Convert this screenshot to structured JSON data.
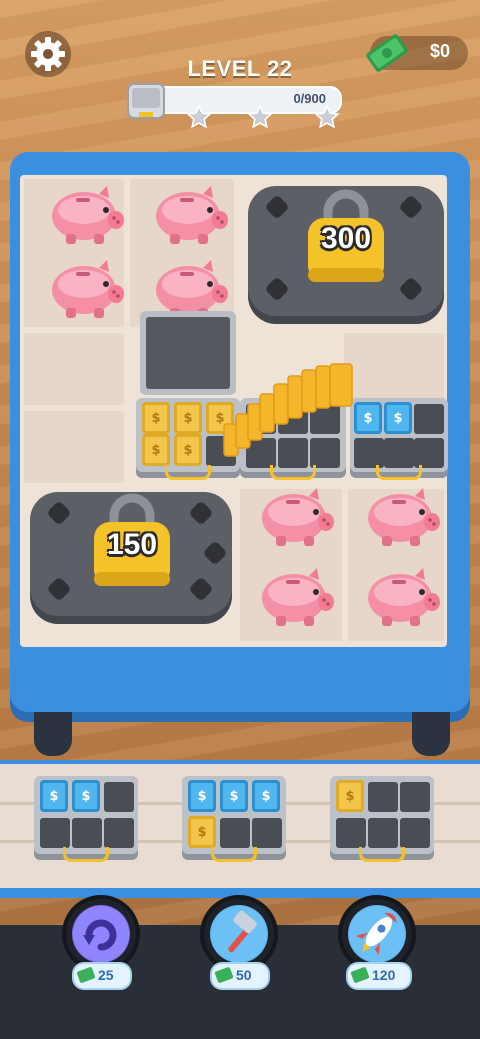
{
  "header": {
    "level": "LEVEL 22",
    "progress_text": "0/900",
    "progress_value": 0,
    "progress_max": 900,
    "money": "$0"
  },
  "board": {
    "locks": [
      {
        "value": "300"
      },
      {
        "value": "150"
      }
    ]
  },
  "boosters": [
    {
      "icon": "refresh-icon",
      "price": "25"
    },
    {
      "icon": "hammer-icon",
      "price": "50"
    },
    {
      "icon": "rocket-icon",
      "price": "120"
    }
  ],
  "colors": {
    "board_blue": "#3b8fe0",
    "lock_yellow": "#f6c229",
    "piggy_pink": "#f48fa5",
    "bill_gold": "#f2c64a",
    "bill_blue": "#4fb6ef"
  }
}
